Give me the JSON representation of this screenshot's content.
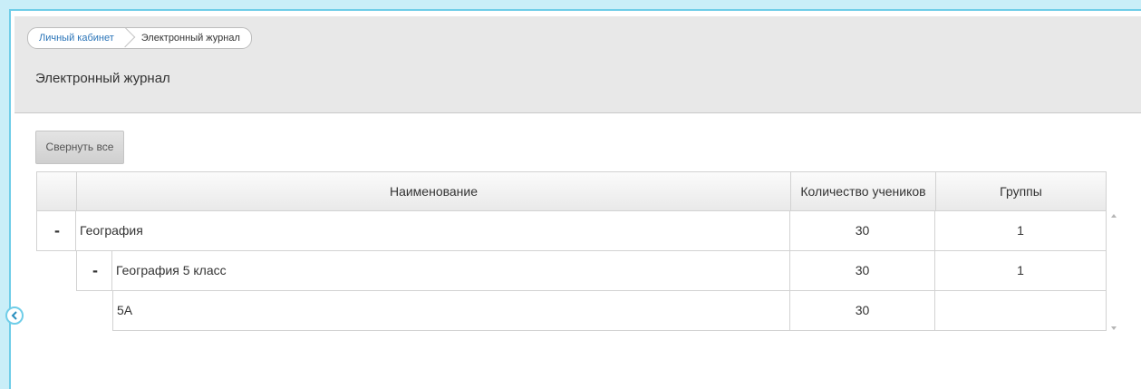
{
  "breadcrumb": {
    "home_label": "Личный кабинет",
    "current_label": "Электронный журнал"
  },
  "page": {
    "title": "Электронный журнал"
  },
  "toolbar": {
    "collapse_all_label": "Свернуть все"
  },
  "grid": {
    "columns": {
      "name": "Наименование",
      "students": "Количество учеников",
      "groups": "Группы"
    },
    "rows": [
      {
        "toggle": "-",
        "name": "География",
        "students": "30",
        "groups": "1"
      },
      {
        "toggle": "-",
        "name": "География 5 класс",
        "students": "30",
        "groups": "1"
      },
      {
        "toggle": "",
        "name": "5А",
        "students": "30",
        "groups": ""
      }
    ]
  },
  "icons": {
    "sidebar_toggle": "chevron-left-icon"
  },
  "colors": {
    "accent_border": "#6fcde8",
    "link": "#2a74b8",
    "header_bg": "#e8e8e8"
  }
}
